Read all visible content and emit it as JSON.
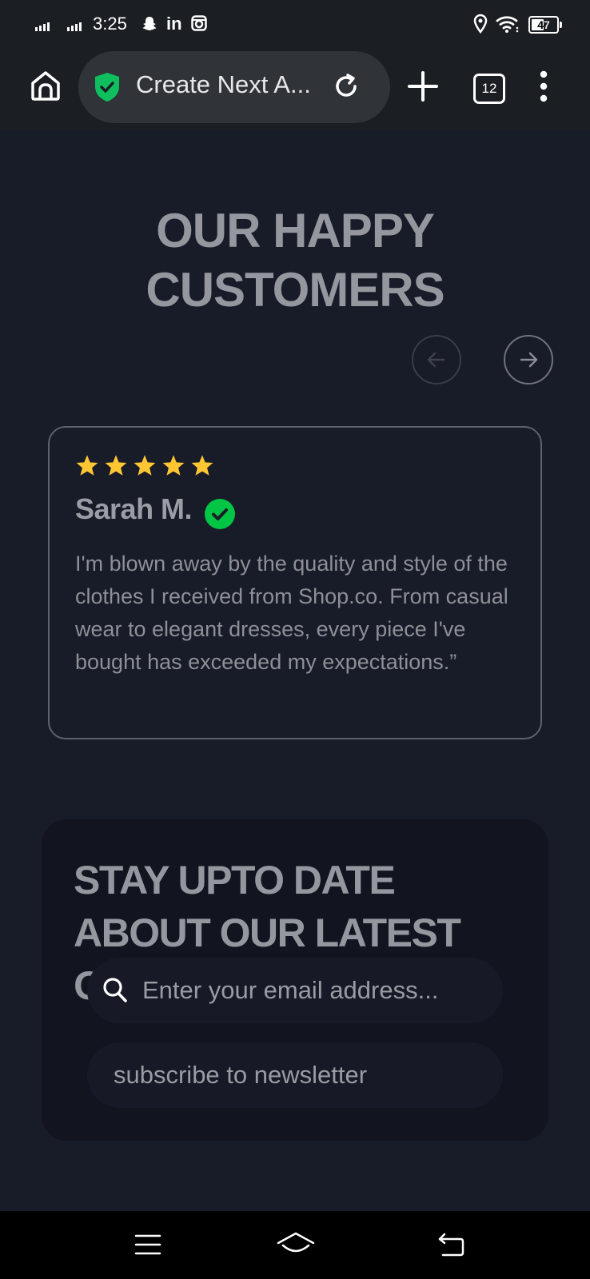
{
  "status_bar": {
    "time": "3:25",
    "battery": "47",
    "linkedin_label": "in"
  },
  "browser": {
    "url_title": "Create Next A...",
    "tab_count": "12"
  },
  "testimonials": {
    "heading_line1": "OUR HAPPY",
    "heading_line2": "CUSTOMERS",
    "review": {
      "rating": 5,
      "reviewer": "Sarah M.",
      "text": "I'm blown away by the quality and style of the clothes I received from Shop.co. From casual wear to elegant dresses, every piece I've bought has exceeded my expectations.”"
    }
  },
  "newsletter": {
    "title": "STAY UPTO DATE ABOUT OUR LATEST OFFERS",
    "email_placeholder": "Enter your email address...",
    "subscribe_label": "subscribe to newsletter"
  },
  "colors": {
    "page_background": "#181b28",
    "verified_badge": "#01c545",
    "star": "#ffc633"
  }
}
